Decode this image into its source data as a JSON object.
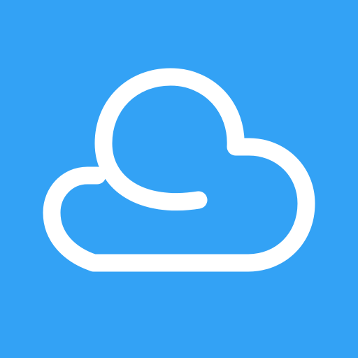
{
  "icon": {
    "name": "cloud-icon",
    "background_color": "#33A2F5",
    "foreground_color": "#FFFFFF"
  }
}
